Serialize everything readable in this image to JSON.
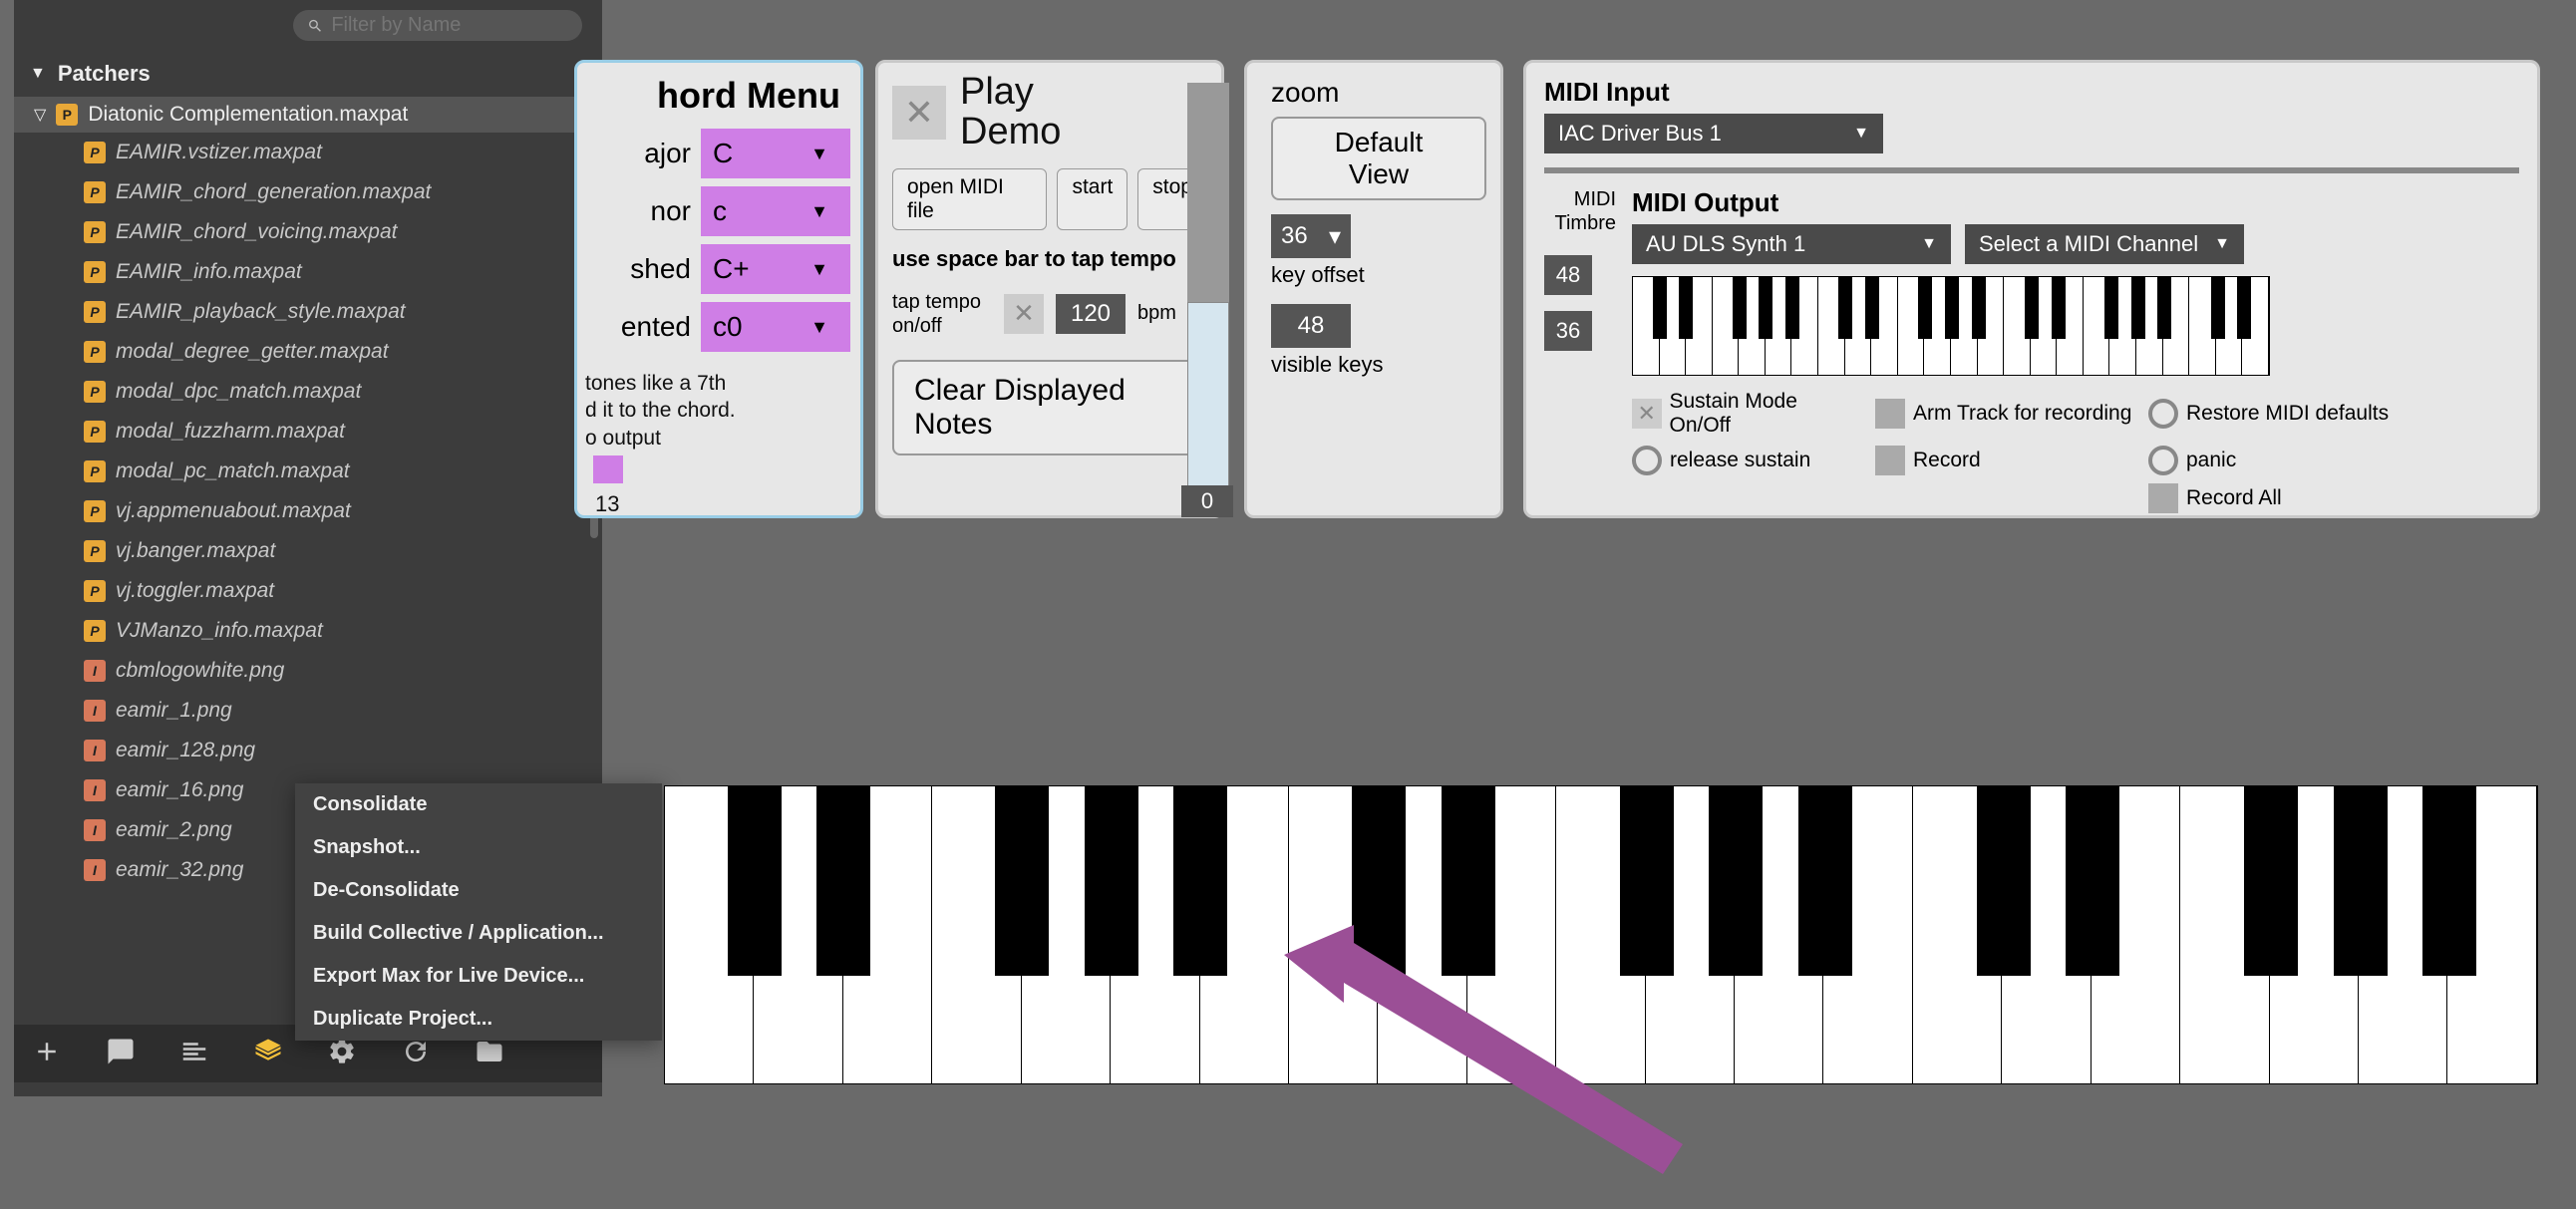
{
  "sidebar": {
    "search_placeholder": "Filter by Name",
    "section": "Patchers",
    "root_file": "Diatonic Complementation.maxpat",
    "files": [
      {
        "name": "EAMIR.vstizer.maxpat",
        "type": "P"
      },
      {
        "name": "EAMIR_chord_generation.maxpat",
        "type": "P"
      },
      {
        "name": "EAMIR_chord_voicing.maxpat",
        "type": "P"
      },
      {
        "name": "EAMIR_info.maxpat",
        "type": "P"
      },
      {
        "name": "EAMIR_playback_style.maxpat",
        "type": "P"
      },
      {
        "name": "modal_degree_getter.maxpat",
        "type": "P"
      },
      {
        "name": "modal_dpc_match.maxpat",
        "type": "P"
      },
      {
        "name": "modal_fuzzharm.maxpat",
        "type": "P"
      },
      {
        "name": "modal_pc_match.maxpat",
        "type": "P"
      },
      {
        "name": "vj.appmenuabout.maxpat",
        "type": "P"
      },
      {
        "name": "vj.banger.maxpat",
        "type": "P"
      },
      {
        "name": "vj.toggler.maxpat",
        "type": "P"
      },
      {
        "name": "VJManzo_info.maxpat",
        "type": "P"
      },
      {
        "name": "cbmlogowhite.png",
        "type": "I"
      },
      {
        "name": "eamir_1.png",
        "type": "I"
      },
      {
        "name": "eamir_128.png",
        "type": "I"
      },
      {
        "name": "eamir_16.png",
        "type": "I"
      },
      {
        "name": "eamir_2.png",
        "type": "I"
      },
      {
        "name": "eamir_32.png",
        "type": "I"
      }
    ]
  },
  "context_menu": {
    "items": [
      "Consolidate",
      "Snapshot...",
      "De-Consolidate",
      "Build Collective / Application...",
      "Export Max for Live Device...",
      "Duplicate Project..."
    ]
  },
  "chord": {
    "title": "hord Menu",
    "rows": [
      {
        "label": "ajor",
        "value": "C"
      },
      {
        "label": "nor",
        "value": "c"
      },
      {
        "label": "shed",
        "value": "C+"
      },
      {
        "label": "ented",
        "value": "c0"
      }
    ],
    "note_line1": "tones like a 7th",
    "note_line2": "d it to the chord.",
    "note_line3": "o output",
    "extra_num": "13"
  },
  "play": {
    "title1": "Play",
    "title2": "Demo",
    "open_btn": "open MIDI file",
    "start_btn": "start",
    "stop_btn": "stop",
    "spacebar": "use space bar to tap tempo",
    "tap_label": "tap tempo on/off",
    "bpm_val": "120",
    "bpm_lbl": "bpm",
    "clear_btn": "Clear Displayed Notes"
  },
  "zoom": {
    "title": "zoom",
    "default_btn1": "Default",
    "default_btn2": "View",
    "val1": "36",
    "lbl1": "key offset",
    "val2": "48",
    "lbl2": "visible keys",
    "zero": "0"
  },
  "midi": {
    "input_lbl": "MIDI Input",
    "input_val": "IAC Driver Bus 1",
    "output_lbl": "MIDI Output",
    "output_val": "AU DLS Synth 1",
    "channel_val": "Select a MIDI Channel",
    "timbre_lbl": "MIDI Timbre",
    "num1": "48",
    "num2": "36",
    "opts": {
      "sustain": "Sustain Mode On/Off",
      "release": "release sustain",
      "arm": "Arm Track for recording",
      "record": "Record",
      "restore": "Restore MIDI defaults",
      "panic": "panic",
      "recordall": "Record All"
    }
  }
}
